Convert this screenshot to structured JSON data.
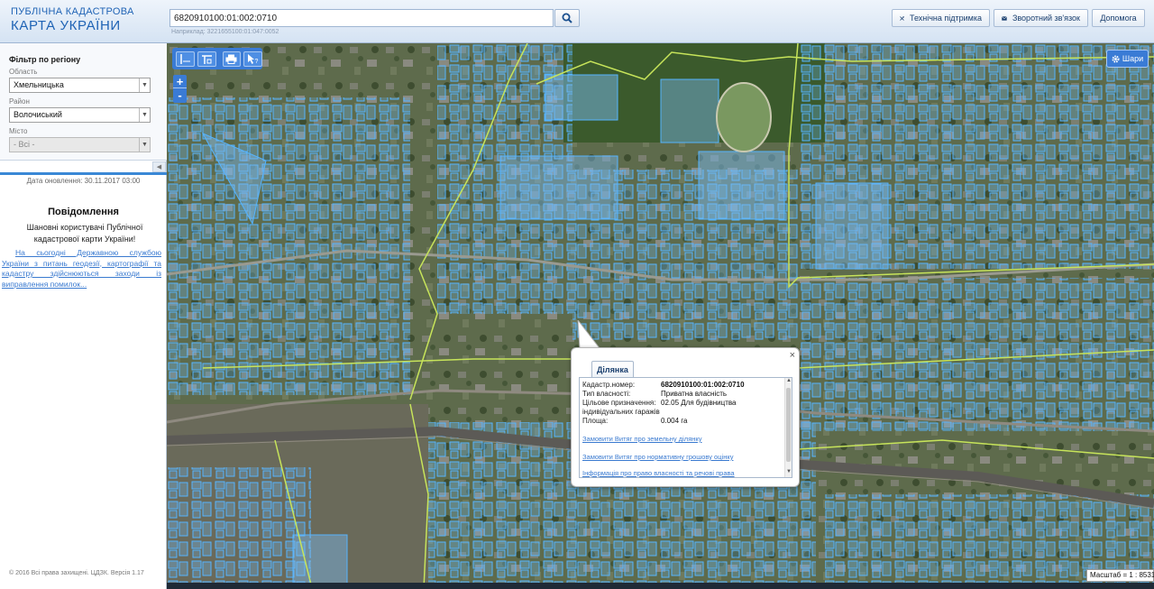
{
  "header": {
    "logo_line1": "ПУБЛІЧНА КАДАСТРОВА",
    "logo_line2": "КАРТА УКРАЇНИ",
    "search_value": "6820910100:01:002:0710",
    "search_hint": "Наприклад: 3221655100:01:047:0052",
    "buttons": {
      "support": "Технічна підтримка",
      "feedback": "Зворотний зв'язок",
      "help": "Допомога"
    }
  },
  "sidebar": {
    "filter_title": "Фільтр по регіону",
    "region_label": "Область",
    "region_value": "Хмельницька",
    "district_label": "Район",
    "district_value": "Волочиський",
    "city_label": "Місто",
    "city_value": "- Всі -",
    "update_date": "Дата оновлення: 30.11.2017 03:00",
    "notice_title": "Повідомлення",
    "notice_intro": "Шановні користувачі Публічної кадастрової карти України!",
    "notice_link": "На сьогодні Державною службою України з питань геодезії, картографії та кадастру здійснюються заходи із виправлення помилок...",
    "copyright": "© 2016 Всі права захищені. ЦДЗК. Версія 1.17"
  },
  "map": {
    "zoom_in": "+",
    "zoom_out": "-",
    "layers_label": "Шари",
    "scale_text": "Масштаб = 1 : 8531",
    "popup": {
      "tab": "Ділянка",
      "close": "×",
      "cadastral_label": "Кадастр.номер:",
      "cadastral_value": "6820910100:01:002:0710",
      "ownership_label": "Тип власності:",
      "ownership_value": "Приватна власність",
      "purpose_label": "Цільове призначення:",
      "purpose_value": "02.05 Для будівництва",
      "purpose_value_cont": "індивідуальних гаражів",
      "area_label": "Площа:",
      "area_value": "0.004 га",
      "link1": "Замовити Витяг про земельну ділянку",
      "link2": "Замовити Витяг про нормативну грошову оцінку",
      "link3": "Інформація про право власності та речові права"
    }
  },
  "colors": {
    "accent": "#3a7bd5",
    "parcel_stroke": "#55b4ff",
    "boundary": "#b9e04a",
    "link": "#3a7ad0"
  }
}
